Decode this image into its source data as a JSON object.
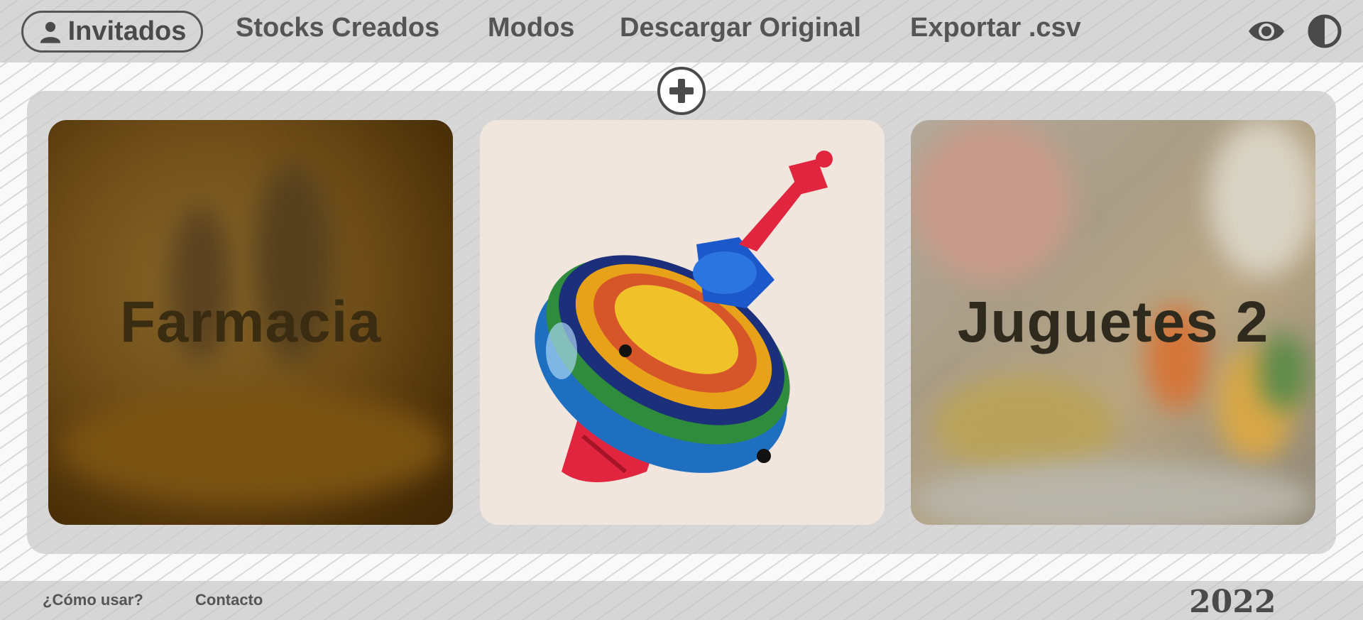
{
  "nav": {
    "user_label": "Invitados",
    "items": [
      "Stocks Creados",
      "Modos",
      "Descargar Original",
      "Exportar .csv"
    ],
    "visibility_icon": "eye-icon",
    "contrast_icon": "contrast-icon"
  },
  "add_button_icon": "plus-icon",
  "cards": [
    {
      "title": "Farmacia"
    },
    {
      "title": ""
    },
    {
      "title": "Juguetes 2"
    }
  ],
  "footer": {
    "links": [
      "¿Cómo usar?",
      "Contacto"
    ],
    "year": "2022"
  },
  "colors": {
    "nav_text": "#555555",
    "panel_bg": "#d7d7d7",
    "card_text": "#2f2a1e"
  }
}
